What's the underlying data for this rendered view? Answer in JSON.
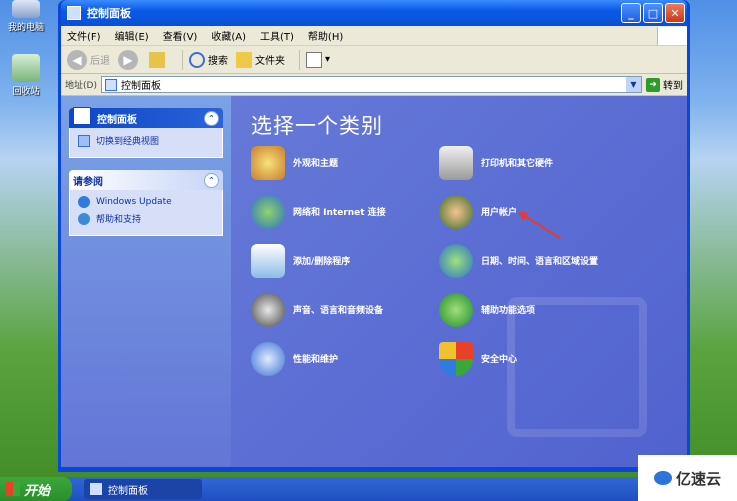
{
  "desktop": {
    "computer_label": "我的电脑",
    "recycle_label": "回收站"
  },
  "window": {
    "title": "控制面板",
    "controls": {
      "minimize": "_",
      "maximize": "□",
      "close": "✕"
    }
  },
  "menubar": {
    "items": [
      "文件(F)",
      "编辑(E)",
      "查看(V)",
      "收藏(A)",
      "工具(T)",
      "帮助(H)"
    ]
  },
  "toolbar": {
    "back_label": "后退",
    "search_label": "搜索",
    "folders_label": "文件夹"
  },
  "address": {
    "label": "地址(D)",
    "value": "控制面板",
    "go_label": "转到"
  },
  "sidebar": {
    "panel1_title": "控制面板",
    "switch_label": "切换到经典视图",
    "panel2_title": "请参阅",
    "windows_update_label": "Windows Update",
    "help_label": "帮助和支持"
  },
  "main": {
    "title": "选择一个类别",
    "categories": [
      "外观和主题",
      "打印机和其它硬件",
      "网络和 Internet 连接",
      "用户帐户",
      "添加/删除程序",
      "日期、时间、语言和区域设置",
      "声音、语言和音频设备",
      "辅助功能选项",
      "性能和维护",
      "安全中心"
    ]
  },
  "taskbar": {
    "start_label": "开始",
    "task_label": "控制面板"
  },
  "watermark": {
    "brand": "亿速云"
  },
  "colors": {
    "titlebar": "#0c5ae8",
    "main_bg": "#5b6dd4",
    "sidebar_link": "#0c32a3",
    "annotation": "#e8392c"
  }
}
